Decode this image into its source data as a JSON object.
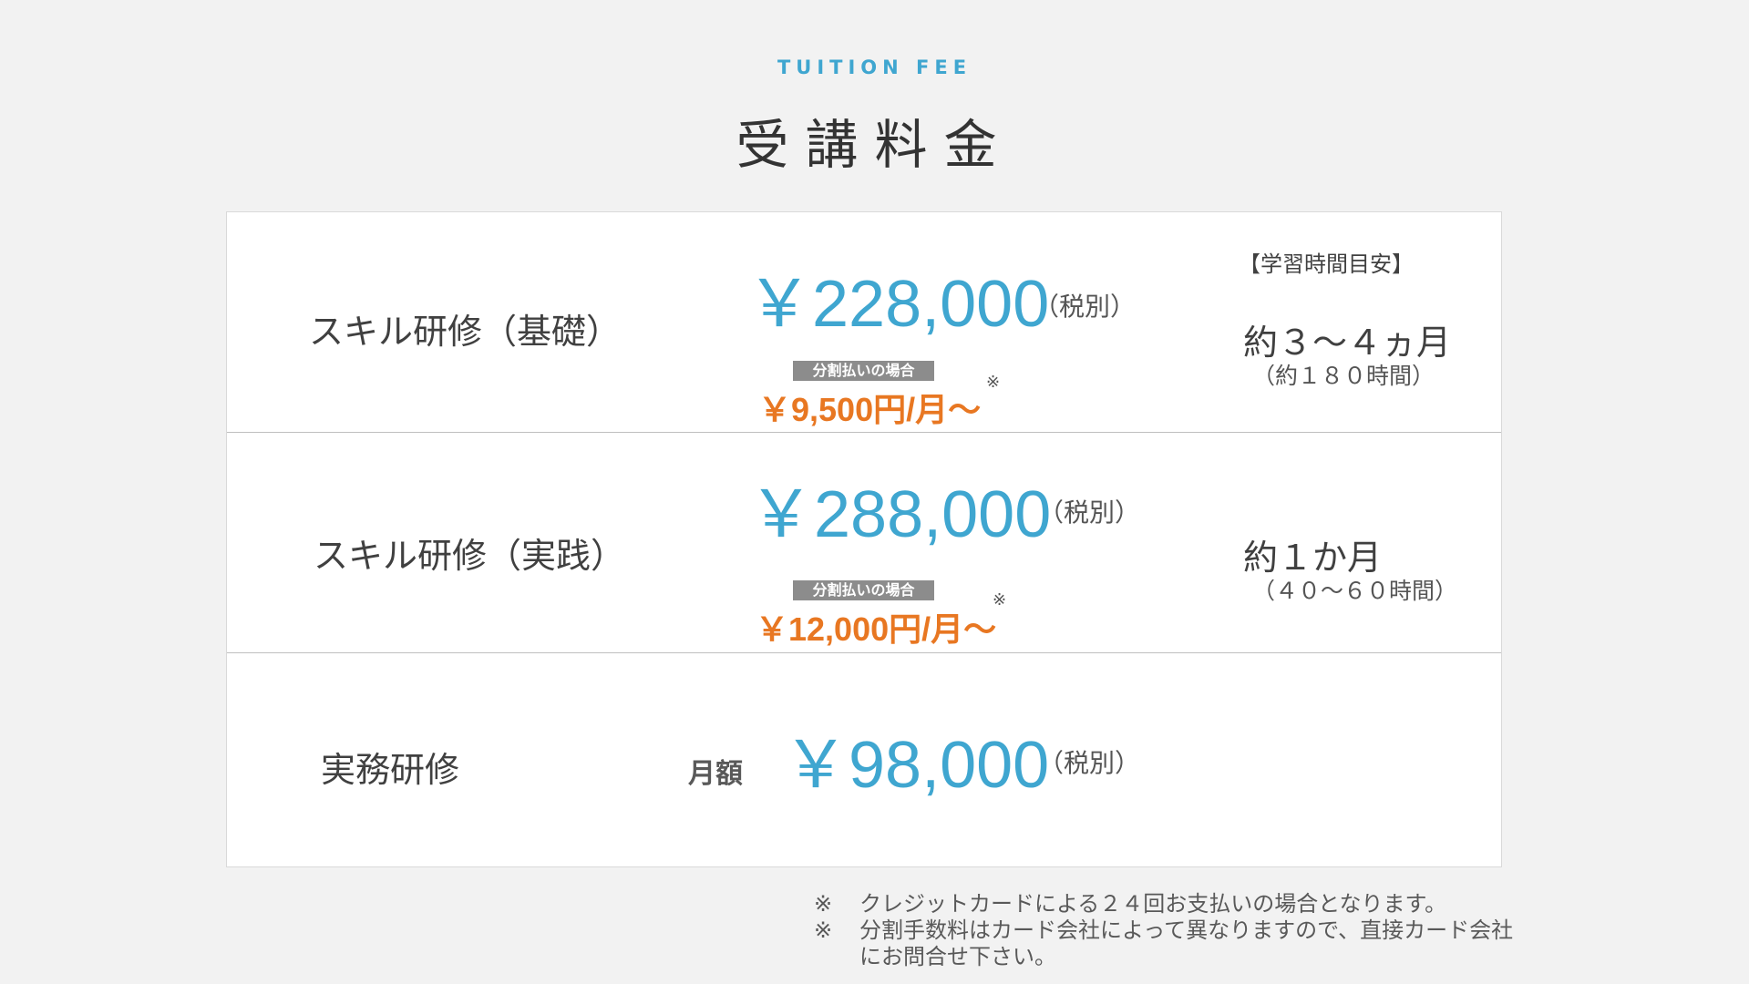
{
  "header": {
    "eyebrow": "TUITION FEE",
    "title": "受講料金"
  },
  "plans": [
    {
      "name": "スキル研修（基礎）",
      "price": "￥228,000",
      "tax": "（税別）",
      "installment_label": "分割払いの場合",
      "installment_price": "￥9,500円/月～",
      "installment_mark": "※",
      "study_heading": "【学習時間目安】",
      "study_main": "約３～４ヵ月",
      "study_sub": "（約１８０時間）"
    },
    {
      "name": "スキル研修（実践）",
      "price": "￥288,000",
      "tax": "（税別）",
      "installment_label": "分割払いの場合",
      "installment_price": "￥12,000円/月～",
      "installment_mark": "※",
      "study_main": "約１か月",
      "study_sub": "（４０～６０時間）"
    },
    {
      "name": "実務研修",
      "monthly_label": "月額",
      "price": "￥98,000",
      "tax": "（税別）"
    }
  ],
  "notes": [
    {
      "mark": "※",
      "text": "クレジットカードによる２４回お支払いの場合となります。"
    },
    {
      "mark": "※",
      "text": "分割手数料はカード会社によって異なりますので、直接カード会社",
      "continuation": "にお問合せ下さい。"
    }
  ],
  "colors": {
    "accent_blue": "#3fa6d0",
    "accent_orange": "#e87722",
    "background": "#f2f2f2"
  }
}
